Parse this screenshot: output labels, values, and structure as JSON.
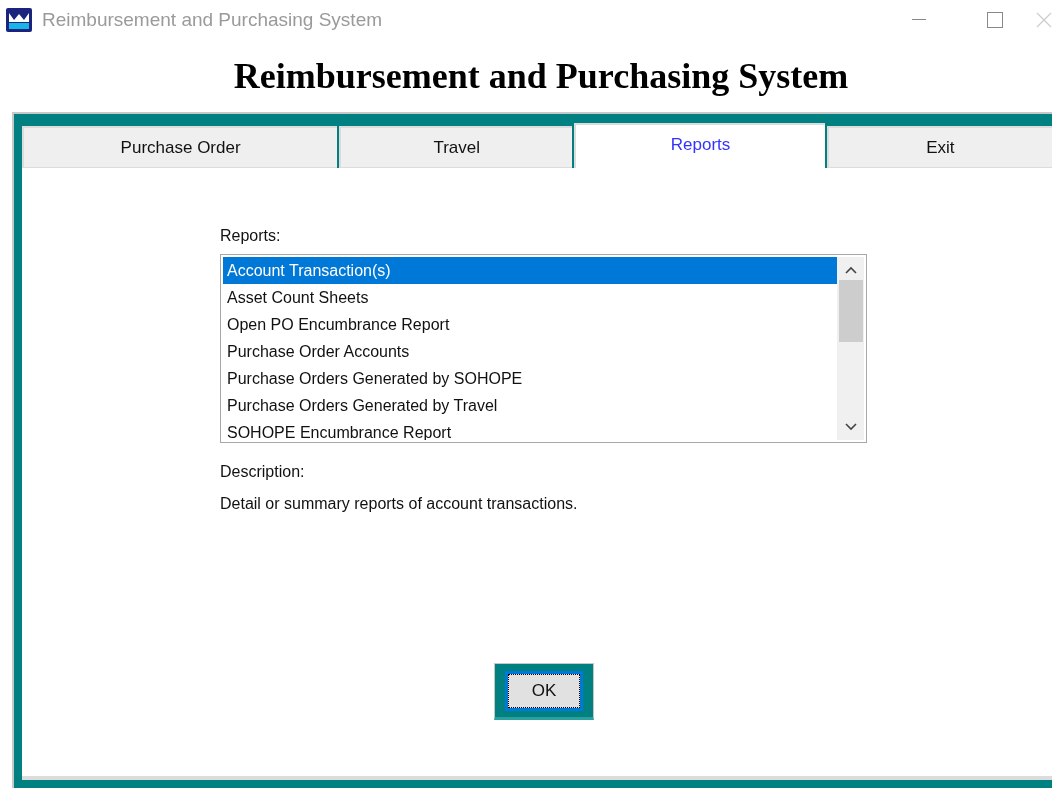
{
  "window": {
    "title": "Reimbursement and Purchasing System"
  },
  "heading": "Reimbursement and Purchasing System",
  "tabs": [
    {
      "label": "Purchase Order",
      "selected": false
    },
    {
      "label": "Travel",
      "selected": false
    },
    {
      "label": "Reports",
      "selected": true
    },
    {
      "label": "Exit",
      "selected": false
    }
  ],
  "reports": {
    "label": "Reports:",
    "items": [
      {
        "label": "Account Transaction(s)",
        "selected": true
      },
      {
        "label": "Asset Count Sheets",
        "selected": false
      },
      {
        "label": "Open PO Encumbrance Report",
        "selected": false
      },
      {
        "label": "Purchase Order Accounts",
        "selected": false
      },
      {
        "label": "Purchase Orders Generated by SOHOPE",
        "selected": false
      },
      {
        "label": "Purchase Orders Generated by Travel",
        "selected": false
      },
      {
        "label": "SOHOPE Encumbrance Report",
        "selected": false
      }
    ]
  },
  "description": {
    "label": "Description:",
    "text": "Detail or summary reports of account transactions."
  },
  "ok_button": {
    "label": "OK"
  }
}
